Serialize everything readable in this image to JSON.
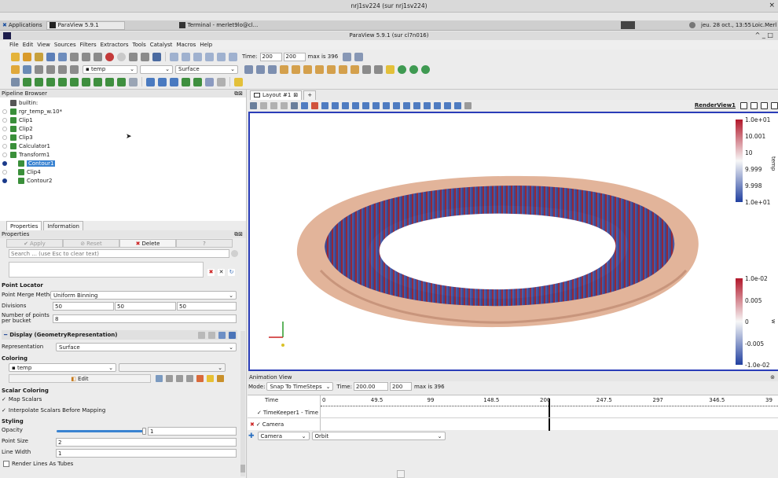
{
  "os_bar": {
    "title": "nrj1sv224 (sur nrj1sv224)",
    "close": "×"
  },
  "taskbar": {
    "applications": "Applications",
    "paraview_task": "ParaView 5.9.1",
    "terminal_task": "Terminal - merlet9lo@cl...",
    "clock": "jeu. 28 oct., 13:55",
    "user": "Loic.Merl"
  },
  "window": {
    "title": "ParaView 5.9.1 (sur cl7n016)",
    "controls": "^ _ □"
  },
  "menu": [
    "File",
    "Edit",
    "View",
    "Sources",
    "Filters",
    "Extractors",
    "Tools",
    "Catalyst",
    "Macros",
    "Help"
  ],
  "toolbar": {
    "time_label": "Time:",
    "time_value": "200",
    "time_index": "200",
    "max_label": "max is 396",
    "color_array": "temp",
    "component": "",
    "representation": "Surface"
  },
  "pipeline": {
    "title": "Pipeline Browser",
    "items": [
      {
        "label": "builtin:",
        "depth": 0,
        "eye": false,
        "selected": false
      },
      {
        "label": "rgr_temp_w.10*",
        "depth": 0,
        "eye": false,
        "selected": false
      },
      {
        "label": "Clip1",
        "depth": 0,
        "eye": false,
        "selected": false
      },
      {
        "label": "Clip2",
        "depth": 0,
        "eye": false,
        "selected": false
      },
      {
        "label": "Clip3",
        "depth": 0,
        "eye": false,
        "selected": false
      },
      {
        "label": "Calculator1",
        "depth": 0,
        "eye": false,
        "selected": false
      },
      {
        "label": "Transform1",
        "depth": 0,
        "eye": false,
        "selected": false
      },
      {
        "label": "Contour1",
        "depth": 1,
        "eye": true,
        "selected": true
      },
      {
        "label": "Clip4",
        "depth": 1,
        "eye": false,
        "selected": false
      },
      {
        "label": "Contour2",
        "depth": 1,
        "eye": true,
        "selected": false
      }
    ]
  },
  "properties": {
    "tab_properties": "Properties",
    "tab_information": "Information",
    "header": "Properties",
    "apply": "Apply",
    "reset": "Reset",
    "delete": "Delete",
    "help": "?",
    "search_placeholder": "Search ... (use Esc to clear text)",
    "point_locator": "Point Locator",
    "merge_method_label": "Point Merge Method",
    "merge_method_value": "Uniform Binning",
    "divisions_label": "Divisions",
    "div_x": "50",
    "div_y": "50",
    "div_z": "50",
    "points_bucket_label": "Number of points per bucket",
    "points_bucket_value": "8",
    "display_header": "Display (GeometryRepresentation)",
    "representation_label": "Representation",
    "representation_value": "Surface",
    "coloring": "Coloring",
    "color_by": "temp",
    "edit": "Edit",
    "scalar_coloring": "Scalar Coloring",
    "map_scalars": "Map Scalars",
    "interpolate": "Interpolate Scalars Before Mapping",
    "styling": "Styling",
    "opacity_label": "Opacity",
    "opacity_value": "1",
    "opacity_level": 1.0,
    "point_size_label": "Point Size",
    "point_size_value": "2",
    "line_width_label": "Line Width",
    "line_width_value": "1",
    "render_tubes": "Render Lines As Tubes"
  },
  "layout": {
    "tab": "Layout #1",
    "add_tab": "+",
    "view_name": "RenderView1"
  },
  "colorbars": {
    "top": {
      "ticks": [
        "1.0e+01",
        "10.001",
        "10",
        "9.999",
        "9.998",
        "1.0e+01"
      ],
      "title": "temp"
    },
    "bottom": {
      "ticks": [
        "1.0e-02",
        "0.005",
        "0",
        "-0.005",
        "-1.0e-02"
      ],
      "title": "w"
    }
  },
  "animation": {
    "title": "Animation View",
    "mode_label": "Mode:",
    "mode_value": "Snap To TimeSteps",
    "time_label": "Time:",
    "time_value": "200.00",
    "time_index": "200",
    "max_label": "max is 396",
    "col_time": "Time",
    "ticks": [
      "0",
      "49.5",
      "99",
      "148.5",
      "200",
      "247.5",
      "297",
      "346.5",
      "39"
    ],
    "current_time": 200,
    "time_range": [
      0,
      396
    ],
    "track1": "TimeKeeper1 - Time",
    "track2": "Camera",
    "add_camera": "Camera",
    "add_mode": "Orbit"
  },
  "colors": {
    "accent_blue": "#2a3db8",
    "selection": "#3a83d1",
    "cmap_red": "#b2182b",
    "cmap_white": "#f7f7f7",
    "cmap_blue": "#2140a0",
    "terrain": "#e2b49a"
  }
}
